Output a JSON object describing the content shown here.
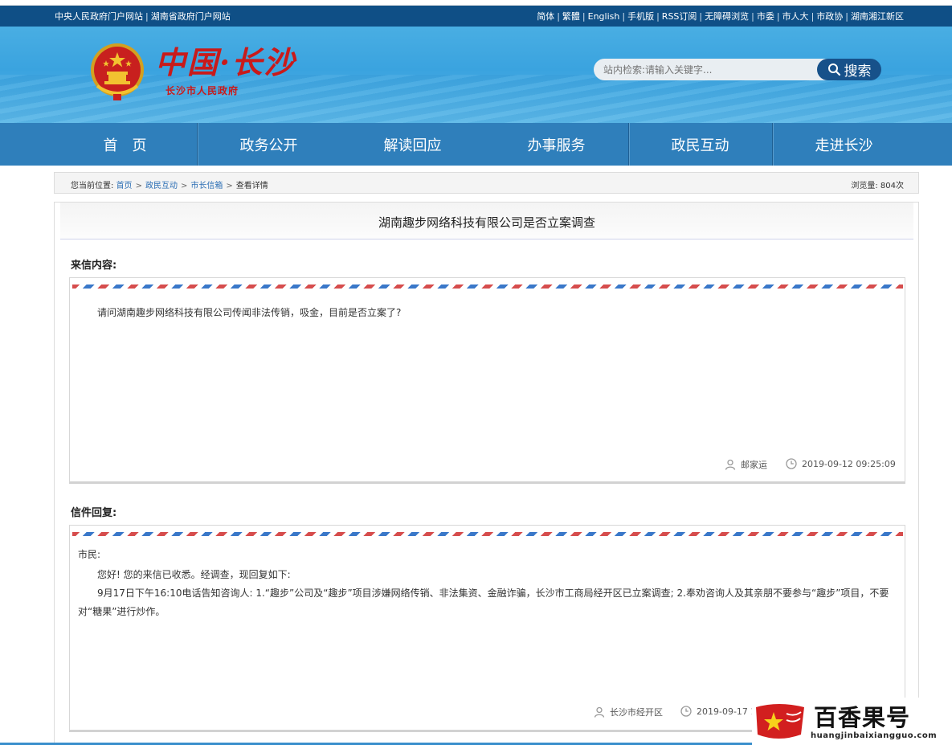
{
  "topbar": {
    "left_links": [
      "中央人民政府门户网站",
      "湖南省政府门户网站"
    ],
    "right_links": [
      "简体",
      "繁體",
      "English",
      "手机版",
      "RSS订阅",
      "无障碍浏览",
      "市委",
      "市人大",
      "市政协",
      "湖南湘江新区"
    ]
  },
  "header": {
    "logo_title": "中国·长沙",
    "logo_subtitle": "长沙市人民政府",
    "search_placeholder": "站内检索:请输入关键字...",
    "search_button": "搜索"
  },
  "nav": {
    "items": [
      "首　页",
      "政务公开",
      "解读回应",
      "办事服务",
      "政民互动",
      "走进长沙"
    ]
  },
  "breadcrumb": {
    "prefix": "您当前位置:",
    "items": [
      "首页",
      "政民互动",
      "市长信箱"
    ],
    "current": "查看详情",
    "views": "浏览量: 804次"
  },
  "letter": {
    "title": "湖南趣步网络科技有限公司是否立案调查",
    "content_label": "来信内容:",
    "content_text": "请问湖南趣步网络科技有限公司传闻非法传销，吸金，目前是否立案了?",
    "author": "邮家运",
    "time": "2019-09-12 09:25:09"
  },
  "reply": {
    "label": "信件回复:",
    "greeting": "市民:",
    "line1": "您好! 您的来信已收悉。经调查，现回复如下:",
    "line2": "9月17日下午16:10电话告知咨询人: 1.“趣步”公司及“趣步”项目涉嫌网络传销、非法集资、金融诈骗，长沙市工商局经开区已立案调查; 2.奉劝咨询人及其亲朋不要参与“趣步”项目，不要对“糖果”进行炒作。",
    "author": "长沙市经开区",
    "time": "2019-09-17 17"
  },
  "watermark": {
    "title": "百香果号",
    "url": "huangjinbaixiangguo.com"
  }
}
